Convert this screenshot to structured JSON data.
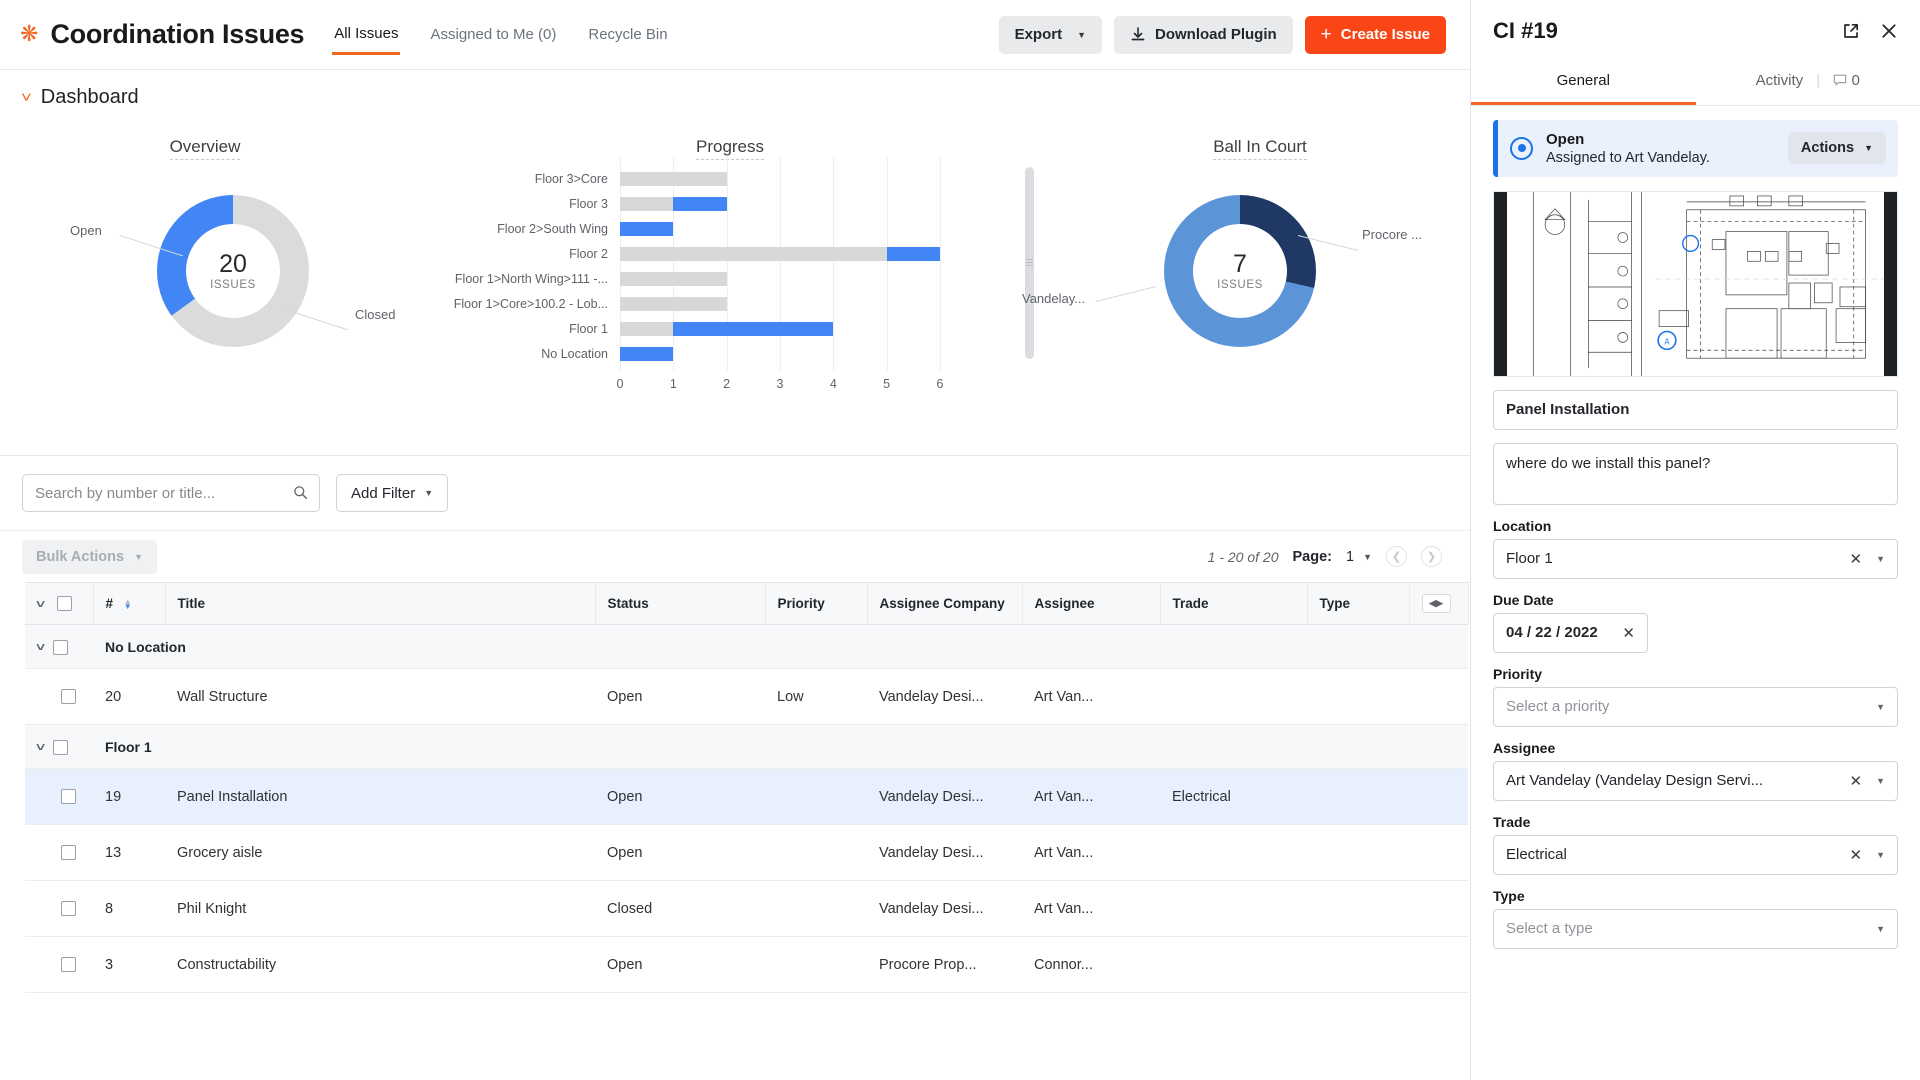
{
  "topbar": {
    "app_icon": "gear-icon",
    "title": "Coordination Issues",
    "tabs": [
      {
        "label": "All Issues",
        "active": true
      },
      {
        "label": "Assigned to Me (0)",
        "active": false
      },
      {
        "label": "Recycle Bin",
        "active": false
      }
    ],
    "export_label": "Export",
    "download_label": "Download Plugin",
    "create_label": "Create Issue",
    "accent_color": "#fa4616"
  },
  "dashboard": {
    "header": "Dashboard",
    "overview_title": "Overview",
    "progress_title": "Progress",
    "ball_title": "Ball In Court"
  },
  "chart_data": [
    {
      "type": "pie",
      "title": "Overview",
      "center_value": "20",
      "center_label": "ISSUES",
      "labels": [
        "Open",
        "Closed"
      ],
      "values": [
        7,
        13
      ],
      "colors": [
        "#4285f4",
        "#d9dbdd"
      ],
      "legend_position": "callout"
    },
    {
      "type": "bar",
      "title": "Progress",
      "orientation": "horizontal",
      "stacked": true,
      "categories": [
        "Floor 3>Core",
        "Floor 3",
        "Floor 2>South Wing",
        "Floor 2",
        "Floor 1>North Wing>111 -...",
        "Floor 1>Core>100.2 - Lob...",
        "Floor 1",
        "No Location"
      ],
      "series": [
        {
          "name": "Closed",
          "color": "#d6d8da",
          "values": [
            2,
            1,
            0,
            5,
            2,
            2,
            1,
            0
          ]
        },
        {
          "name": "Open",
          "color": "#4285f4",
          "values": [
            0,
            1,
            1,
            1,
            0,
            0,
            3,
            1
          ]
        }
      ],
      "xlabel": "",
      "ylabel": "",
      "xlim": [
        0,
        6
      ],
      "xticks": [
        "0",
        "1",
        "2",
        "3",
        "4",
        "5",
        "6"
      ],
      "grid": true
    },
    {
      "type": "pie",
      "title": "Ball In Court",
      "center_value": "7",
      "center_label": "ISSUES",
      "labels": [
        "Procore ...",
        "Vandelay..."
      ],
      "values": [
        2,
        5
      ],
      "colors": [
        "#1f3864",
        "#5b95d8"
      ],
      "legend_position": "callout"
    }
  ],
  "toolbar": {
    "search_placeholder": "Search by number or title...",
    "search_value": "",
    "add_filter_label": "Add Filter",
    "bulk_actions_label": "Bulk Actions",
    "page_count": "1 - 20 of 20",
    "page_label": "Page:",
    "page_value": "1"
  },
  "table": {
    "columns": [
      "#",
      "Title",
      "Status",
      "Priority",
      "Assignee Company",
      "Assignee",
      "Trade",
      "Type"
    ],
    "groups": [
      {
        "name": "No Location",
        "rows": [
          {
            "num": "20",
            "title": "Wall Structure",
            "status": "Open",
            "priority": "Low",
            "company": "Vandelay Desi...",
            "assignee": "Art Van...",
            "trade": "",
            "type": "",
            "selected": false
          }
        ]
      },
      {
        "name": "Floor 1",
        "rows": [
          {
            "num": "19",
            "title": "Panel Installation",
            "status": "Open",
            "priority": "",
            "company": "Vandelay Desi...",
            "assignee": "Art Van...",
            "trade": "Electrical",
            "type": "",
            "selected": true
          },
          {
            "num": "13",
            "title": "Grocery aisle",
            "status": "Open",
            "priority": "",
            "company": "Vandelay Desi...",
            "assignee": "Art Van...",
            "trade": "",
            "type": "",
            "selected": false
          },
          {
            "num": "8",
            "title": "Phil Knight",
            "status": "Closed",
            "priority": "",
            "company": "Vandelay Desi...",
            "assignee": "Art Van...",
            "trade": "",
            "type": "",
            "selected": false
          },
          {
            "num": "3",
            "title": "Constructability",
            "status": "Open",
            "priority": "",
            "company": "Procore Prop...",
            "assignee": "Connor...",
            "trade": "",
            "type": "",
            "selected": false
          }
        ]
      }
    ]
  },
  "panel": {
    "title": "CI #19",
    "tabs": {
      "general": "General",
      "activity": "Activity",
      "comment_count": "0"
    },
    "status": {
      "state": "Open",
      "assigned_text": "Assigned to Art Vandelay.",
      "actions_label": "Actions"
    },
    "fields": {
      "title_value": "Panel Installation",
      "description_value": "where do we install this panel?",
      "location_label": "Location",
      "location_value": "Floor 1",
      "due_date_label": "Due Date",
      "due_date_value": "04 / 22 / 2022",
      "priority_label": "Priority",
      "priority_placeholder": "Select a priority",
      "assignee_label": "Assignee",
      "assignee_value": "Art Vandelay (Vandelay Design Servi...",
      "trade_label": "Trade",
      "trade_value": "Electrical",
      "type_label": "Type",
      "type_placeholder": "Select a type"
    }
  }
}
